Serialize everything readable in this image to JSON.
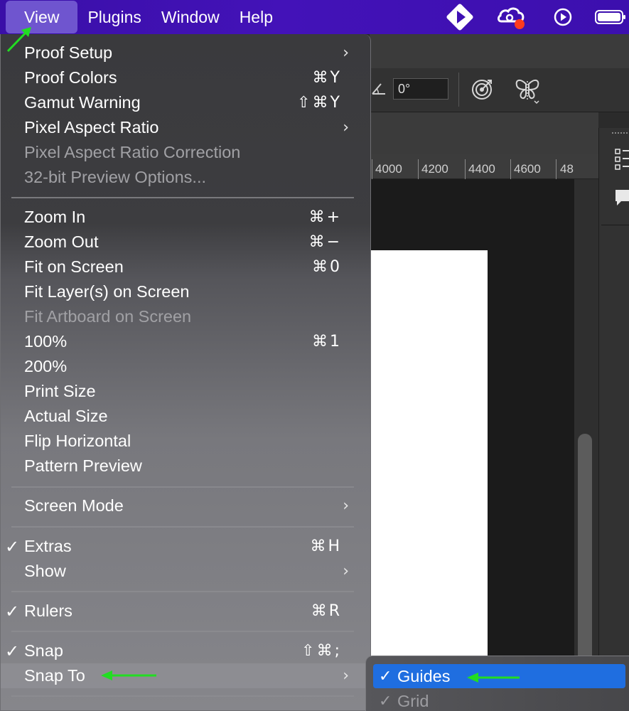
{
  "menubar": {
    "items": [
      "View",
      "Plugins",
      "Window",
      "Help"
    ],
    "active": "View"
  },
  "options_bar": {
    "angle_value": "0°"
  },
  "ruler": {
    "labels": [
      "4000",
      "4200",
      "4400",
      "4600",
      "48"
    ]
  },
  "view_menu": {
    "items": [
      {
        "label": "Proof Setup",
        "shortcut": "",
        "submenu": true,
        "checked": false,
        "disabled": false
      },
      {
        "label": "Proof Colors",
        "shortcut": "⌘Y",
        "submenu": false,
        "checked": false,
        "disabled": false
      },
      {
        "label": "Gamut Warning",
        "shortcut": "⇧⌘Y",
        "submenu": false,
        "checked": false,
        "disabled": false
      },
      {
        "label": "Pixel Aspect Ratio",
        "shortcut": "",
        "submenu": true,
        "checked": false,
        "disabled": false
      },
      {
        "label": "Pixel Aspect Ratio Correction",
        "shortcut": "",
        "submenu": false,
        "checked": false,
        "disabled": true
      },
      {
        "label": "32-bit Preview Options...",
        "shortcut": "",
        "submenu": false,
        "checked": false,
        "disabled": true
      },
      {
        "label": "Zoom In",
        "shortcut": "⌘+",
        "submenu": false,
        "checked": false,
        "disabled": false
      },
      {
        "label": "Zoom Out",
        "shortcut": "⌘−",
        "submenu": false,
        "checked": false,
        "disabled": false
      },
      {
        "label": "Fit on Screen",
        "shortcut": "⌘0",
        "submenu": false,
        "checked": false,
        "disabled": false
      },
      {
        "label": "Fit Layer(s) on Screen",
        "shortcut": "",
        "submenu": false,
        "checked": false,
        "disabled": false
      },
      {
        "label": "Fit Artboard on Screen",
        "shortcut": "",
        "submenu": false,
        "checked": false,
        "disabled": true
      },
      {
        "label": "100%",
        "shortcut": "⌘1",
        "submenu": false,
        "checked": false,
        "disabled": false
      },
      {
        "label": "200%",
        "shortcut": "",
        "submenu": false,
        "checked": false,
        "disabled": false
      },
      {
        "label": "Print Size",
        "shortcut": "",
        "submenu": false,
        "checked": false,
        "disabled": false
      },
      {
        "label": "Actual Size",
        "shortcut": "",
        "submenu": false,
        "checked": false,
        "disabled": false
      },
      {
        "label": "Flip Horizontal",
        "shortcut": "",
        "submenu": false,
        "checked": false,
        "disabled": false
      },
      {
        "label": "Pattern Preview",
        "shortcut": "",
        "submenu": false,
        "checked": false,
        "disabled": false
      },
      {
        "label": "Screen Mode",
        "shortcut": "",
        "submenu": true,
        "checked": false,
        "disabled": false
      },
      {
        "label": "Extras",
        "shortcut": "⌘H",
        "submenu": false,
        "checked": true,
        "disabled": false
      },
      {
        "label": "Show",
        "shortcut": "",
        "submenu": true,
        "checked": false,
        "disabled": false
      },
      {
        "label": "Rulers",
        "shortcut": "⌘R",
        "submenu": false,
        "checked": true,
        "disabled": false
      },
      {
        "label": "Snap",
        "shortcut": "⇧⌘;",
        "submenu": false,
        "checked": true,
        "disabled": false
      },
      {
        "label": "Snap To",
        "shortcut": "",
        "submenu": true,
        "checked": false,
        "disabled": false,
        "highlighted": true
      }
    ]
  },
  "snap_to_submenu": {
    "items": [
      {
        "label": "Guides",
        "checked": true,
        "selected": true
      },
      {
        "label": "Grid",
        "checked": true,
        "selected": false
      }
    ]
  },
  "glyphs": {
    "check": "✓",
    "chevron": "›"
  },
  "colors": {
    "menubar": "#3f10b4",
    "selection_blue": "#1f6ee0",
    "annotation_green": "#22dd22"
  }
}
